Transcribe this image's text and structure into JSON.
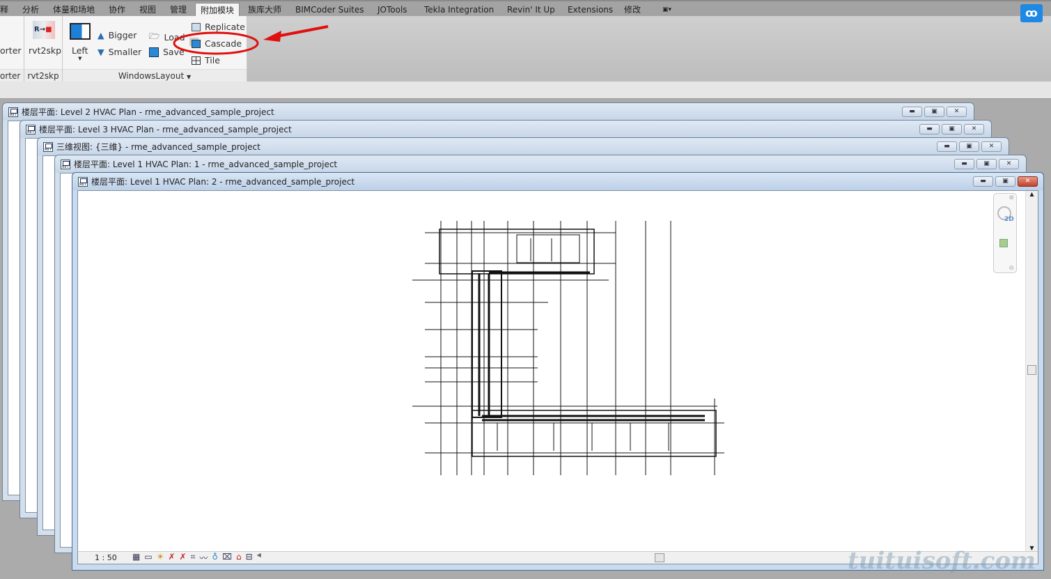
{
  "tabs": [
    {
      "label": "释"
    },
    {
      "label": "分析"
    },
    {
      "label": "体量和场地"
    },
    {
      "label": "协作"
    },
    {
      "label": "视图"
    },
    {
      "label": "管理"
    },
    {
      "label": "附加模块",
      "active": true
    },
    {
      "label": "族库大师"
    },
    {
      "label": "BIMCoder Suites"
    },
    {
      "label": "JOTools"
    },
    {
      "label": "Tekla Integration"
    },
    {
      "label": "Revin' It Up"
    },
    {
      "label": "Extensions"
    },
    {
      "label": "修改"
    }
  ],
  "ribbon": {
    "exporter": {
      "button": "orter",
      "panel": "orter"
    },
    "rvt2skp": {
      "button": "rvt2skp",
      "panel": "rvt2skp"
    },
    "windows_layout": {
      "panel": "WindowsLayout",
      "left": "Left",
      "bigger": "Bigger",
      "smaller": "Smaller",
      "load": "Load",
      "save": "Save",
      "replicate": "Replicate",
      "cascade": "Cascade",
      "tile": "Tile"
    }
  },
  "windows": [
    {
      "title": "楼层平面: Level 2 HVAC Plan - rme_advanced_sample_project"
    },
    {
      "title": "楼层平面: Level 3 HVAC Plan - rme_advanced_sample_project"
    },
    {
      "title": "三维视图: {三维} - rme_advanced_sample_project"
    },
    {
      "title": "楼层平面: Level 1 HVAC Plan: 1 - rme_advanced_sample_project"
    },
    {
      "title": "楼层平面: Level 1 HVAC Plan: 2 - rme_advanced_sample_project",
      "active": true
    }
  ],
  "status": {
    "scale": "1 : 50"
  },
  "navbar": {
    "badge": "2D"
  },
  "watermark": "tuituisoft.com",
  "colors": {
    "annotation": "#e01010",
    "accent": "#1e88e5"
  }
}
